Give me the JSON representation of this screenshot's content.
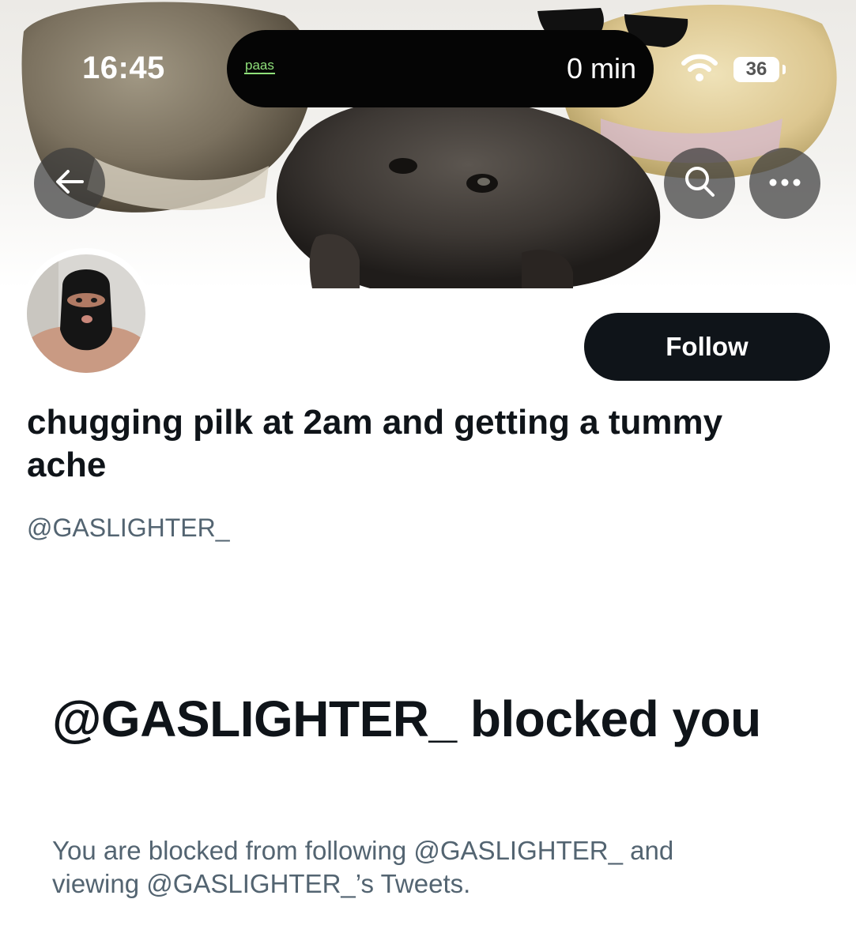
{
  "status_bar": {
    "time": "16:45",
    "activity_label": "paas",
    "activity_timer": "0 min",
    "battery": "36",
    "icons": [
      "wifi-icon",
      "battery-icon"
    ]
  },
  "nav": {
    "icons": [
      "back-arrow-icon",
      "search-icon",
      "more-icon"
    ]
  },
  "profile": {
    "display_name": "chugging pilk at 2am and getting a tummy ache",
    "handle": "@GASLIGHTER_",
    "follow_label": "Follow"
  },
  "blocked": {
    "title": "@GASLIGHTER_ blocked you",
    "description": "You are blocked from following @GASLIGHTER_ and viewing @GASLIGHTER_’s Tweets."
  },
  "colors": {
    "primary_text": "#0f1419",
    "secondary_text": "#536471",
    "follow_button": "#0f1419",
    "overlay_button": "#3c3c3c"
  }
}
